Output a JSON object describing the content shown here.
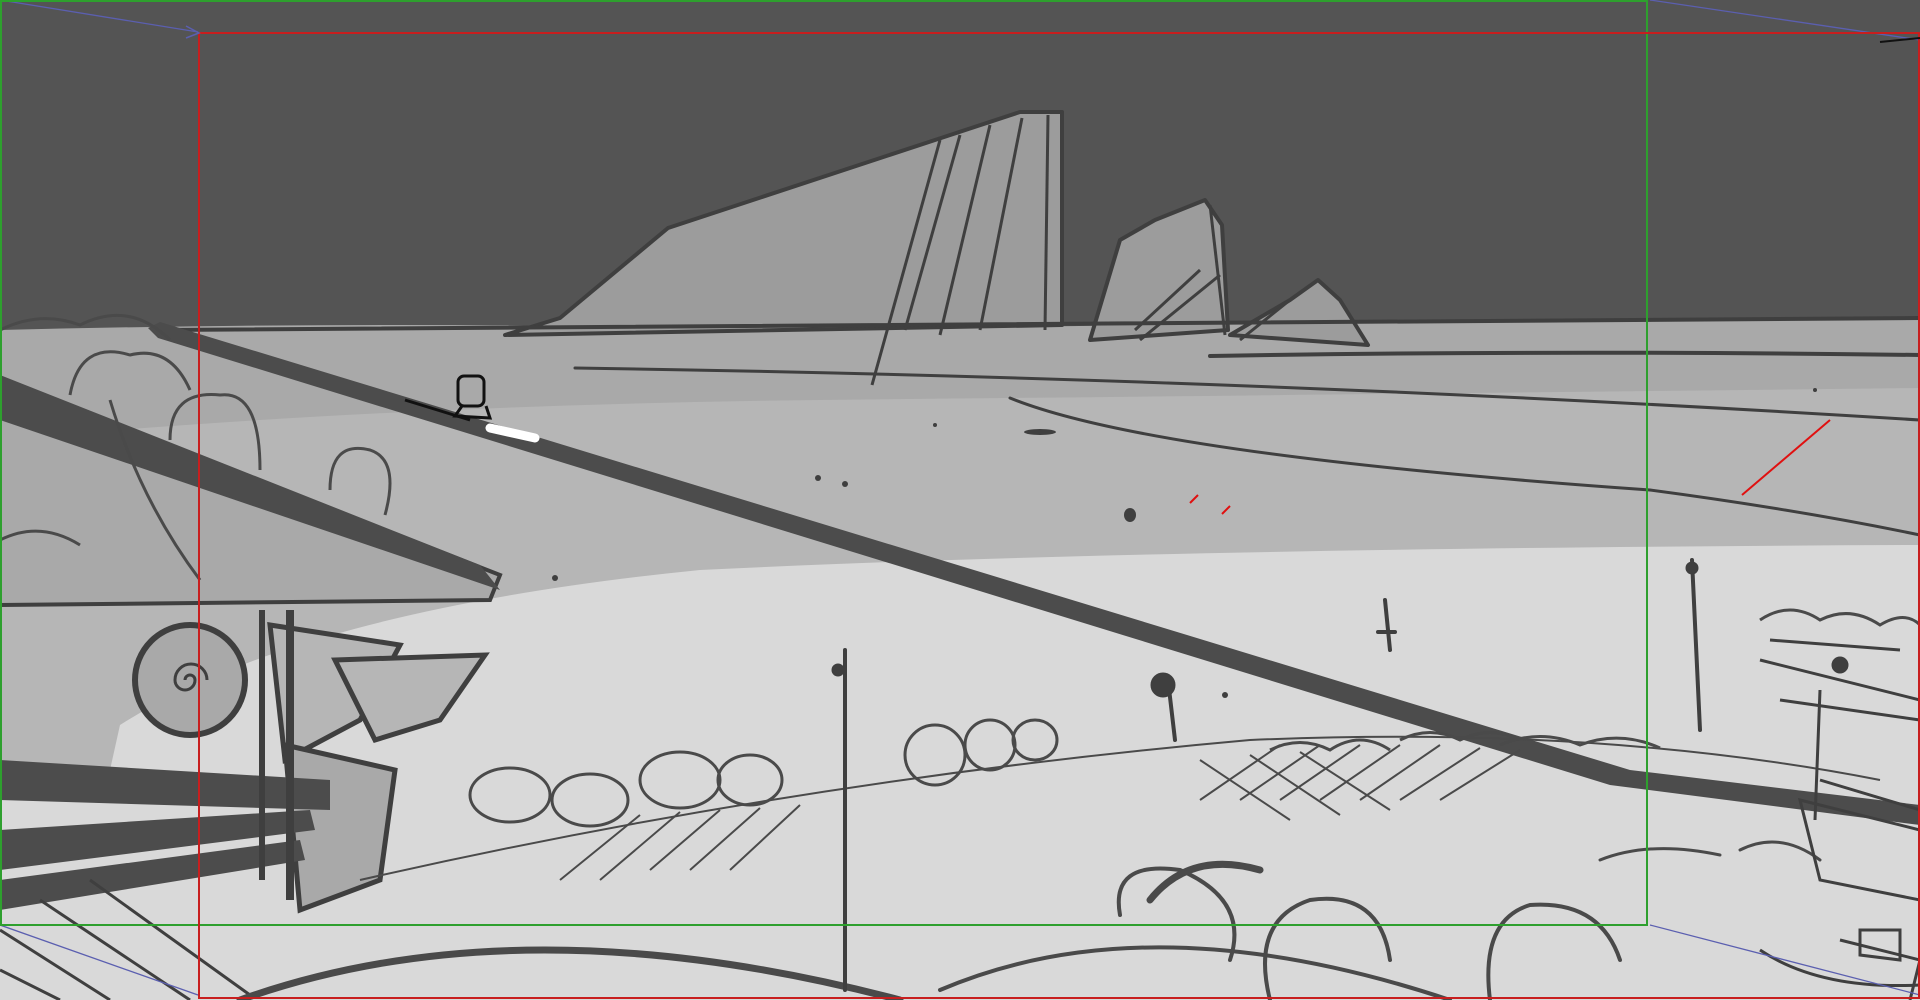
{
  "canvas": {
    "colors": {
      "sky": "#545454",
      "far_plain": "#a9a9a9",
      "mid_plain": "#b6b6b6",
      "near_ground": "#d9d9d9",
      "cliff": "#9c9c9c",
      "line": "#3f3f3f",
      "sketch_stroke": "#4a4a4a",
      "beam": "#4c4c4c",
      "frame_outer": "#2ea02e",
      "frame_inner": "#c81e1e",
      "guide": "#5b5fb0",
      "red_mark": "#e01010",
      "highlight": "#ffffff"
    }
  },
  "frames": {
    "outer_label": "",
    "inner_label": ""
  }
}
